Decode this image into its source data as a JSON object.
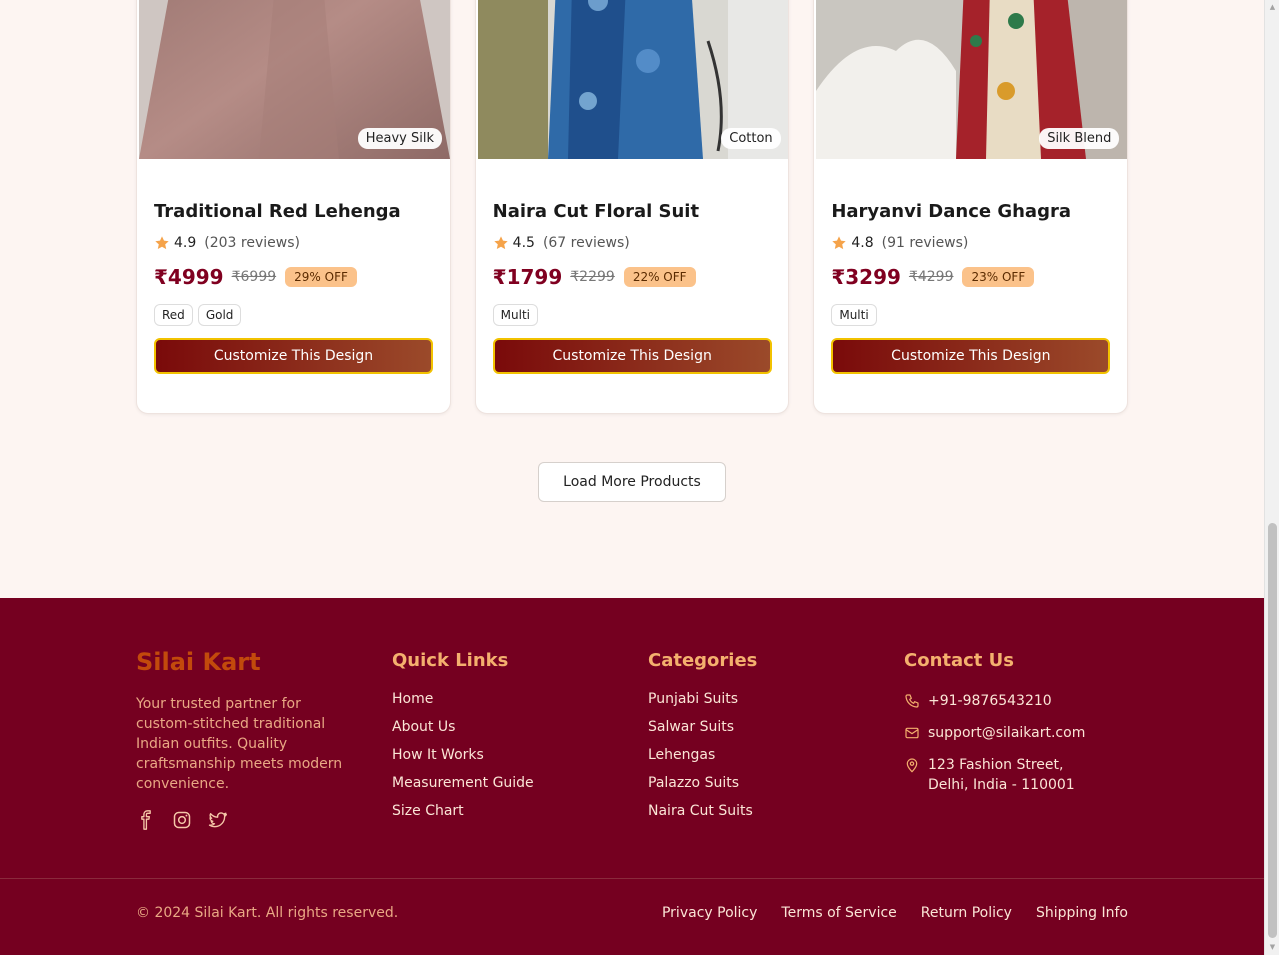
{
  "products": [
    {
      "title": "Traditional Red Lehenga",
      "fabric": "Heavy Silk",
      "rating": "4.9",
      "reviews": "(203 reviews)",
      "price": "₹4999",
      "old_price": "₹6999",
      "discount": "29% OFF",
      "colors": [
        "Red",
        "Gold"
      ],
      "cta": "Customize This Design"
    },
    {
      "title": "Naira Cut Floral Suit",
      "fabric": "Cotton",
      "rating": "4.5",
      "reviews": "(67 reviews)",
      "price": "₹1799",
      "old_price": "₹2299",
      "discount": "22% OFF",
      "colors": [
        "Multi"
      ],
      "cta": "Customize This Design"
    },
    {
      "title": "Haryanvi Dance Ghagra",
      "fabric": "Silk Blend",
      "rating": "4.8",
      "reviews": "(91 reviews)",
      "price": "₹3299",
      "old_price": "₹4299",
      "discount": "23% OFF",
      "colors": [
        "Multi"
      ],
      "cta": "Customize This Design"
    }
  ],
  "load_more": "Load More Products",
  "footer": {
    "brand": "Silai Kart",
    "description": "Your trusted partner for custom-stitched traditional Indian outfits. Quality craftsmanship meets modern convenience.",
    "socials": [
      "facebook-icon",
      "instagram-icon",
      "twitter-icon"
    ],
    "quick_links": {
      "title": "Quick Links",
      "items": [
        "Home",
        "About Us",
        "How It Works",
        "Measurement Guide",
        "Size Chart"
      ]
    },
    "categories": {
      "title": "Categories",
      "items": [
        "Punjabi Suits",
        "Salwar Suits",
        "Lehengas",
        "Palazzo Suits",
        "Naira Cut Suits"
      ]
    },
    "contact": {
      "title": "Contact Us",
      "phone": "+91-9876543210",
      "email": "support@silaikart.com",
      "address_line1": "123 Fashion Street,",
      "address_line2": "Delhi, India - 110001"
    },
    "copyright": "© 2024 Silai Kart. All rights reserved.",
    "legal": [
      "Privacy Policy",
      "Terms of Service",
      "Return Policy",
      "Shipping Info"
    ]
  },
  "colors": {
    "maroon": "#750020",
    "price": "#800020",
    "accent": "#f4b06e",
    "button_border": "#f2c200"
  }
}
